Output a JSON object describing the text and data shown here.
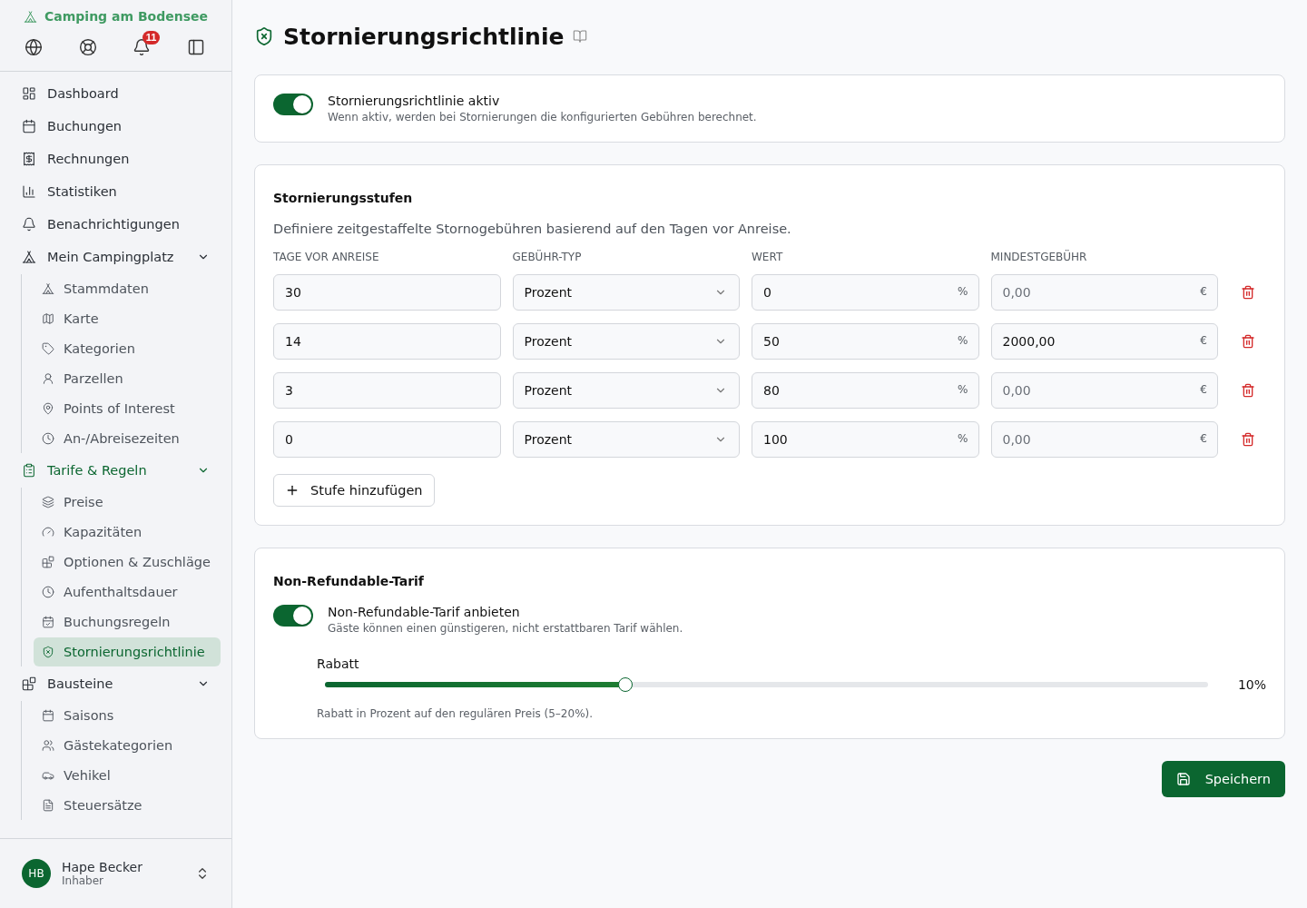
{
  "sidebar": {
    "brand": "Camping am Bodensee",
    "notification_badge": "11",
    "items": [
      {
        "label": "Dashboard",
        "selected": false
      },
      {
        "label": "Buchungen",
        "selected": false
      },
      {
        "label": "Rechnungen",
        "selected": false
      },
      {
        "label": "Statistiken",
        "selected": false
      },
      {
        "label": "Benachrichtigungen",
        "selected": false
      },
      {
        "label": "Mein Campingplatz",
        "selected": false,
        "expanded": true,
        "children": [
          {
            "label": "Stammdaten",
            "selected": false
          },
          {
            "label": "Karte",
            "selected": false
          },
          {
            "label": "Kategorien",
            "selected": false
          },
          {
            "label": "Parzellen",
            "selected": false
          },
          {
            "label": "Points of Interest",
            "selected": false
          },
          {
            "label": "An-/Abreisezeiten",
            "selected": false
          }
        ]
      },
      {
        "label": "Tarife & Regeln",
        "selected": true,
        "expanded": true,
        "children": [
          {
            "label": "Preise",
            "selected": false
          },
          {
            "label": "Kapazitäten",
            "selected": false
          },
          {
            "label": "Optionen & Zuschläge",
            "selected": false
          },
          {
            "label": "Aufenthaltsdauer",
            "selected": false
          },
          {
            "label": "Buchungsregeln",
            "selected": false
          },
          {
            "label": "Stornierungsrichtlinie",
            "selected": true
          }
        ]
      },
      {
        "label": "Bausteine",
        "selected": false,
        "expanded": true,
        "children": [
          {
            "label": "Saisons",
            "selected": false
          },
          {
            "label": "Gästekategorien",
            "selected": false
          },
          {
            "label": "Vehikel",
            "selected": false
          },
          {
            "label": "Steuersätze",
            "selected": false
          }
        ]
      }
    ],
    "user": {
      "initials": "HB",
      "name": "Hape Becker",
      "role": "Inhaber"
    }
  },
  "page": {
    "title": "Stornierungsrichtlinie"
  },
  "policy_toggle": {
    "label": "Stornierungsrichtlinie aktiv",
    "description": "Wenn aktiv, werden bei Stornierungen die konfigurierten Gebühren berechnet.",
    "on": true
  },
  "tiers": {
    "title": "Stornierungsstufen",
    "description": "Definiere zeitgestaffelte Stornogebühren basierend auf den Tagen vor Anreise.",
    "columns": [
      "TAGE VOR ANREISE",
      "GEBÜHR-TYP",
      "WERT",
      "MINDESTGEBÜHR"
    ],
    "rows": [
      {
        "days": "30",
        "fee_type": "Prozent",
        "value": "0",
        "value_unit": "%",
        "min_fee": {
          "placeholder": "0,00"
        },
        "min_fee_unit": "€"
      },
      {
        "days": "14",
        "fee_type": "Prozent",
        "value": "50",
        "value_unit": "%",
        "min_fee": {
          "value": "2000,00"
        },
        "min_fee_unit": "€"
      },
      {
        "days": "3",
        "fee_type": "Prozent",
        "value": "80",
        "value_unit": "%",
        "min_fee": {
          "placeholder": "0,00"
        },
        "min_fee_unit": "€"
      },
      {
        "days": "0",
        "fee_type": "Prozent",
        "value": "100",
        "value_unit": "%",
        "min_fee": {
          "placeholder": "0,00"
        },
        "min_fee_unit": "€"
      }
    ],
    "add_button": "Stufe hinzufügen"
  },
  "non_refundable": {
    "title": "Non-Refundable-Tarif",
    "toggle": {
      "label": "Non-Refundable-Tarif anbieten",
      "description": "Gäste können einen günstigeren, nicht erstattbaren Tarif wählen.",
      "on": true
    },
    "slider": {
      "label": "Rabatt",
      "level": 0.34,
      "reading": "10%",
      "hint": "Rabatt in Prozent auf den regulären Preis (5–20%)."
    }
  },
  "save_button": "Speichern"
}
